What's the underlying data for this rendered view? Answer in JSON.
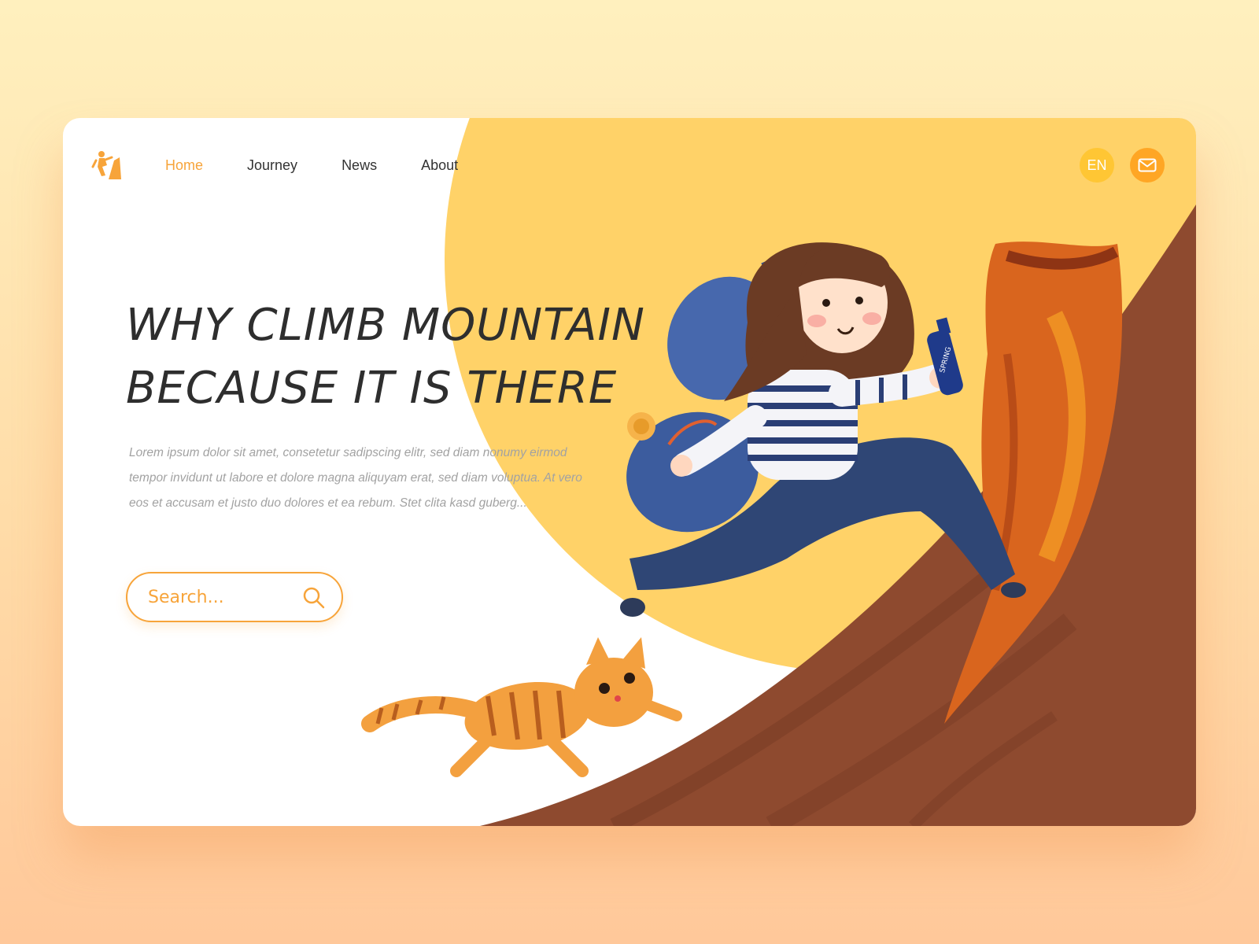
{
  "nav": {
    "items": [
      {
        "label": "Home",
        "active": true
      },
      {
        "label": "Journey",
        "active": false
      },
      {
        "label": "News",
        "active": false
      },
      {
        "label": "About",
        "active": false
      }
    ]
  },
  "header": {
    "language": "EN"
  },
  "hero": {
    "title_line1": "WHY CLIMB MOUNTAIN",
    "title_line2": "BECAUSE IT IS THERE",
    "description": "Lorem ipsum dolor sit amet, consetetur sadipscing elitr, sed diam nonumy eirmod tempor invidunt ut labore et dolore magna aliquyam erat, sed diam voluptua. At vero eos et accusam et justo duo dolores et ea rebum. Stet clita kasd guberg...",
    "bottle_label": "SPRING"
  },
  "search": {
    "placeholder": "Search..."
  },
  "colors": {
    "accent": "#f7a43a",
    "sun": "#ffd268",
    "mountain": "#8e4a2f",
    "rock": "#d9651e",
    "text": "#2e2e2e"
  },
  "icons": {
    "logo": "climber-icon",
    "mail": "mail-icon",
    "search": "search-icon"
  }
}
